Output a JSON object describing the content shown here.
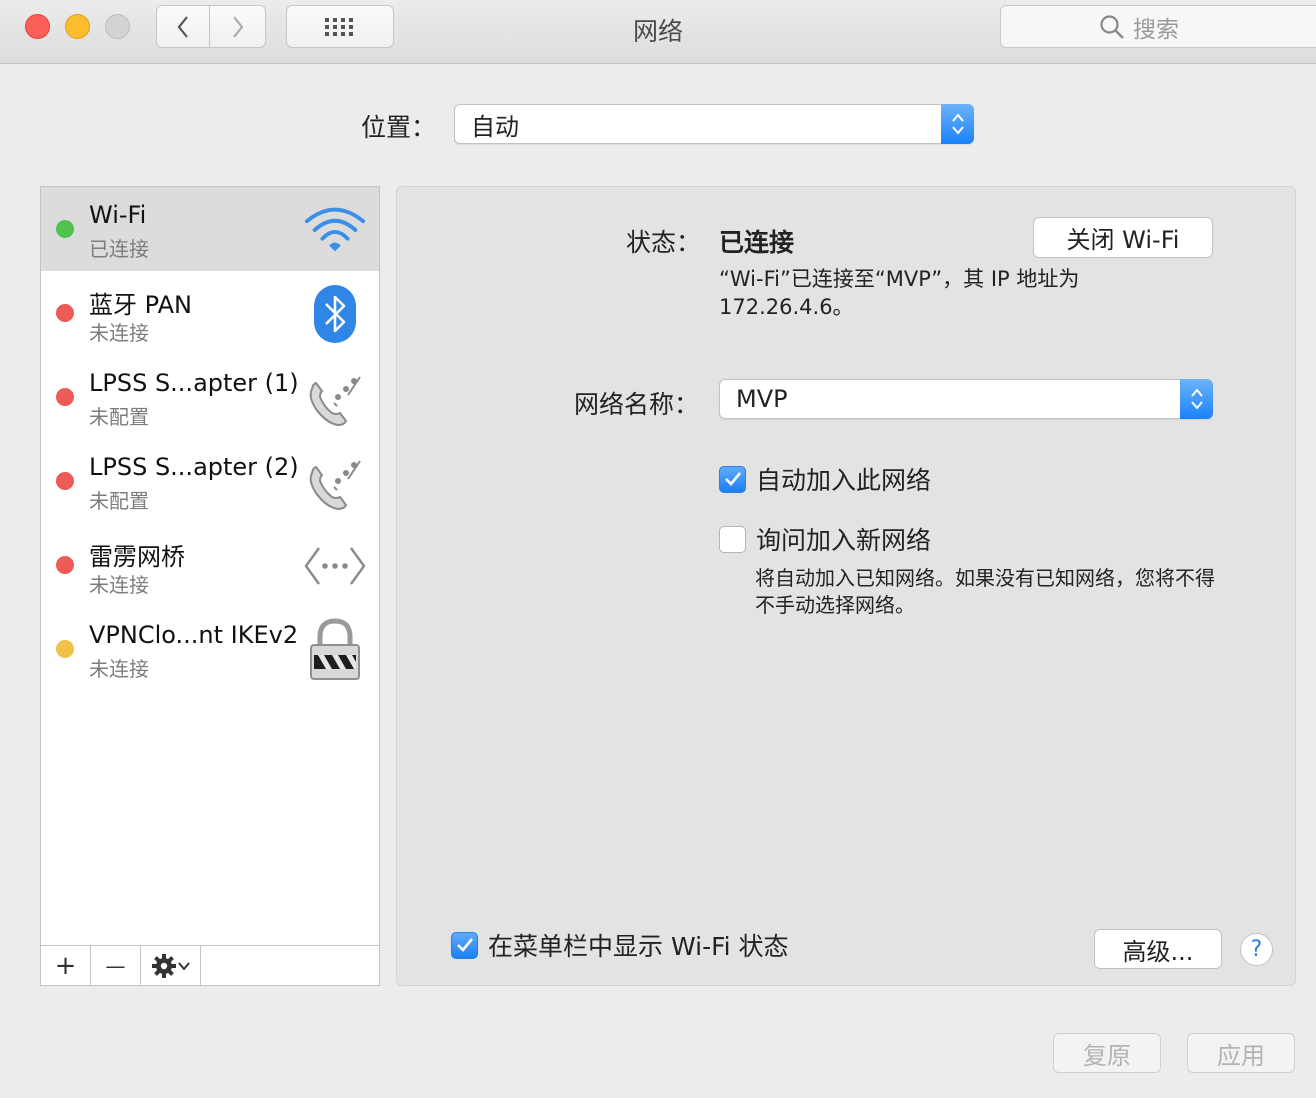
{
  "window": {
    "title": "网络",
    "search_placeholder": "搜索"
  },
  "location": {
    "label": "位置：",
    "value": "自动"
  },
  "services": [
    {
      "name": "Wi-Fi",
      "status": "已连接",
      "dot_color": "#4fc34c",
      "icon": "wifi-icon",
      "selected": true
    },
    {
      "name": "蓝牙 PAN",
      "status": "未连接",
      "dot_color": "#ec5b55",
      "icon": "bluetooth-icon",
      "selected": false
    },
    {
      "name": "LPSS S...apter (1)",
      "status": "未配置",
      "dot_color": "#ec5b55",
      "icon": "phone-modem-icon",
      "selected": false
    },
    {
      "name": "LPSS S...apter (2)",
      "status": "未配置",
      "dot_color": "#ec5b55",
      "icon": "phone-modem-icon",
      "selected": false
    },
    {
      "name": "雷雳网桥",
      "status": "未连接",
      "dot_color": "#ec5b55",
      "icon": "bridge-arrows-icon",
      "selected": false
    },
    {
      "name": "VPNClo...nt IKEv2",
      "status": "未连接",
      "dot_color": "#f1c14a",
      "icon": "vpn-lock-icon",
      "selected": false
    }
  ],
  "list_toolbar": {
    "add": "+",
    "remove": "—"
  },
  "detail": {
    "status_label": "状态：",
    "status_value": "已连接",
    "turn_off_button": "关闭 Wi-Fi",
    "status_description": "“Wi-Fi”已连接至“MVP”，其 IP 地址为 172.26.4.6。",
    "network_name_label": "网络名称：",
    "network_name_value": "MVP",
    "auto_join_label": "自动加入此网络",
    "auto_join_checked": true,
    "ask_join_label": "询问加入新网络",
    "ask_join_checked": false,
    "ask_join_description": "将自动加入已知网络。如果没有已知网络，您将不得不手动选择网络。",
    "show_menubar_label": "在菜单栏中显示 Wi-Fi 状态",
    "show_menubar_checked": true,
    "advanced_button": "高级...",
    "help_button": "?"
  },
  "bottom": {
    "revert_button": "复原",
    "apply_button": "应用"
  },
  "colors": {
    "accent": "#1b7ff5",
    "connected": "#4fc34c",
    "disconnected": "#ec5b55",
    "warning": "#f1c14a"
  }
}
